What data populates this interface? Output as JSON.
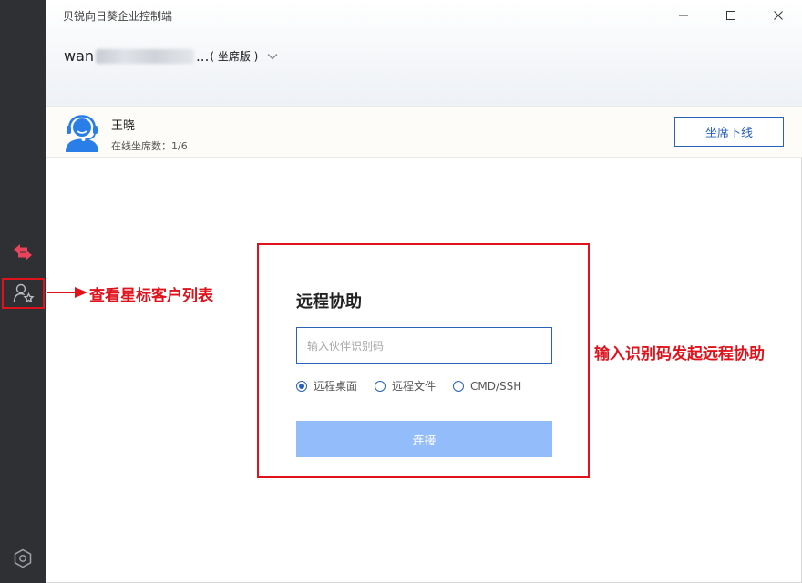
{
  "app": {
    "title": "贝锐向日葵企业控制端"
  },
  "account": {
    "name_prefix": "wan",
    "ellipsis": "...",
    "edition": "( 坐席版 )"
  },
  "agent": {
    "name": "王晓",
    "status": "在线坐席数：1/6",
    "offline_button": "坐席下线"
  },
  "assist": {
    "title": "远程协助",
    "code_placeholder": "输入伙伴识别码",
    "code_value": "",
    "options": [
      "远程桌面",
      "远程文件",
      "CMD/SSH"
    ],
    "selected_option": "远程桌面",
    "connect_button": "连接"
  },
  "annotations": {
    "star_list": "查看星标客户列表",
    "enter_code": "输入识别码发起远程协助"
  },
  "icons": {
    "swap": "swap-arrows-icon",
    "star_customers": "user-star-icon",
    "settings": "hexagon-settings-icon",
    "minimize": "minimize-icon",
    "maximize": "maximize-icon",
    "close": "close-icon",
    "dropdown": "chevron-down-icon",
    "agent": "headset-agent-icon"
  },
  "colors": {
    "sidebar": "#2f3033",
    "accent": "#2a62b8",
    "connect_disabled": "#93bdfa",
    "annotation": "#e0121b",
    "swap_icon": "#e8435a"
  }
}
